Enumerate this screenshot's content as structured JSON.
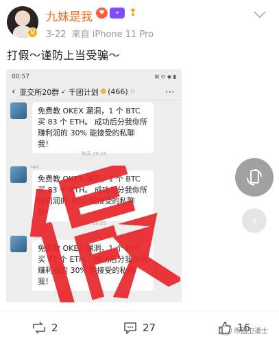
{
  "post": {
    "username": "九妹是我",
    "time": "3-22",
    "source": "来自 iPhone 11 Pro",
    "text": "打假～谨防上当受骗～",
    "verified_mark": "V"
  },
  "screenshot": {
    "status_time": "00:57",
    "status_right": "⊠ ⊙ ◆ ▮",
    "chat_title": "亚交所20群",
    "chat_subtitle": "千团计划",
    "member_count": "(466)",
    "sender_name": "Hell",
    "message": "免费教 OKEX 漏洞，1 个 BTC 买 83 个 ETH。 成功后分我你所赚利润的 30% 能接受的私聊我！",
    "timestamps": [
      "昨天 20:24",
      "昨天 20:25"
    ],
    "stamp_text": "假"
  },
  "actions": {
    "repost_count": "2",
    "comment_count": "27",
    "like_count": "16"
  },
  "watermark": "币圈卫道士",
  "colors": {
    "username": "#f26f1b",
    "stamp": "#e8262b"
  }
}
